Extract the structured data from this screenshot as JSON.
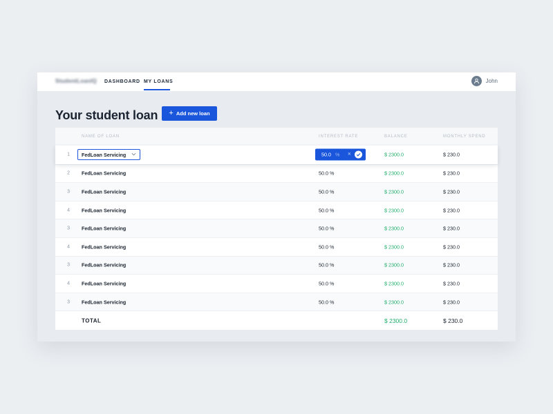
{
  "app": {
    "logo": "StudentLoanIQ"
  },
  "nav": {
    "dashboard": "DASHBOARD",
    "my_loans": "MY LOANS"
  },
  "user": {
    "name": "John"
  },
  "page": {
    "title": "Your student loan",
    "add_button": "Add new loan"
  },
  "table": {
    "headers": {
      "name": "NAME OF LOAN",
      "rate": "INTEREST RATE",
      "balance": "BALANCE",
      "spend": "MONTHLY SPEND"
    },
    "editing": {
      "rate_value": "50.0",
      "rate_unit": "%"
    },
    "rows": [
      {
        "num": "1",
        "name": "FedLoan Servicing",
        "rate": "50.0 %",
        "balance": "$ 2300.0",
        "spend": "$ 230.0"
      },
      {
        "num": "2",
        "name": "FedLoan Servicing",
        "rate": "50.0 %",
        "balance": "$ 2300.0",
        "spend": "$ 230.0"
      },
      {
        "num": "3",
        "name": "FedLoan Servicing",
        "rate": "50.0 %",
        "balance": "$ 2300.0",
        "spend": "$ 230.0"
      },
      {
        "num": "4",
        "name": "FedLoan Servicing",
        "rate": "50.0 %",
        "balance": "$ 2300.0",
        "spend": "$ 230.0"
      },
      {
        "num": "3",
        "name": "FedLoan Servicing",
        "rate": "50.0 %",
        "balance": "$ 2300.0",
        "spend": "$ 230.0"
      },
      {
        "num": "4",
        "name": "FedLoan Servicing",
        "rate": "50.0 %",
        "balance": "$ 2300.0",
        "spend": "$ 230.0"
      },
      {
        "num": "3",
        "name": "FedLoan Servicing",
        "rate": "50.0 %",
        "balance": "$ 2300.0",
        "spend": "$ 230.0"
      },
      {
        "num": "4",
        "name": "FedLoan Servicing",
        "rate": "50.0 %",
        "balance": "$ 2300.0",
        "spend": "$ 230.0"
      },
      {
        "num": "3",
        "name": "FedLoan Servicing",
        "rate": "50.0 %",
        "balance": "$ 2300.0",
        "spend": "$ 230.0"
      }
    ],
    "total": {
      "label": "TOTAL",
      "balance": "$ 2300.0",
      "spend": "$ 230.0"
    }
  },
  "colors": {
    "accent": "#1a56db",
    "positive": "#1fae6b",
    "background": "#eceff2"
  },
  "icons": {
    "avatar": "user-icon",
    "add": "plus-icon",
    "select": "chevron-down-icon",
    "clear": "close-icon",
    "confirm": "check-icon"
  }
}
